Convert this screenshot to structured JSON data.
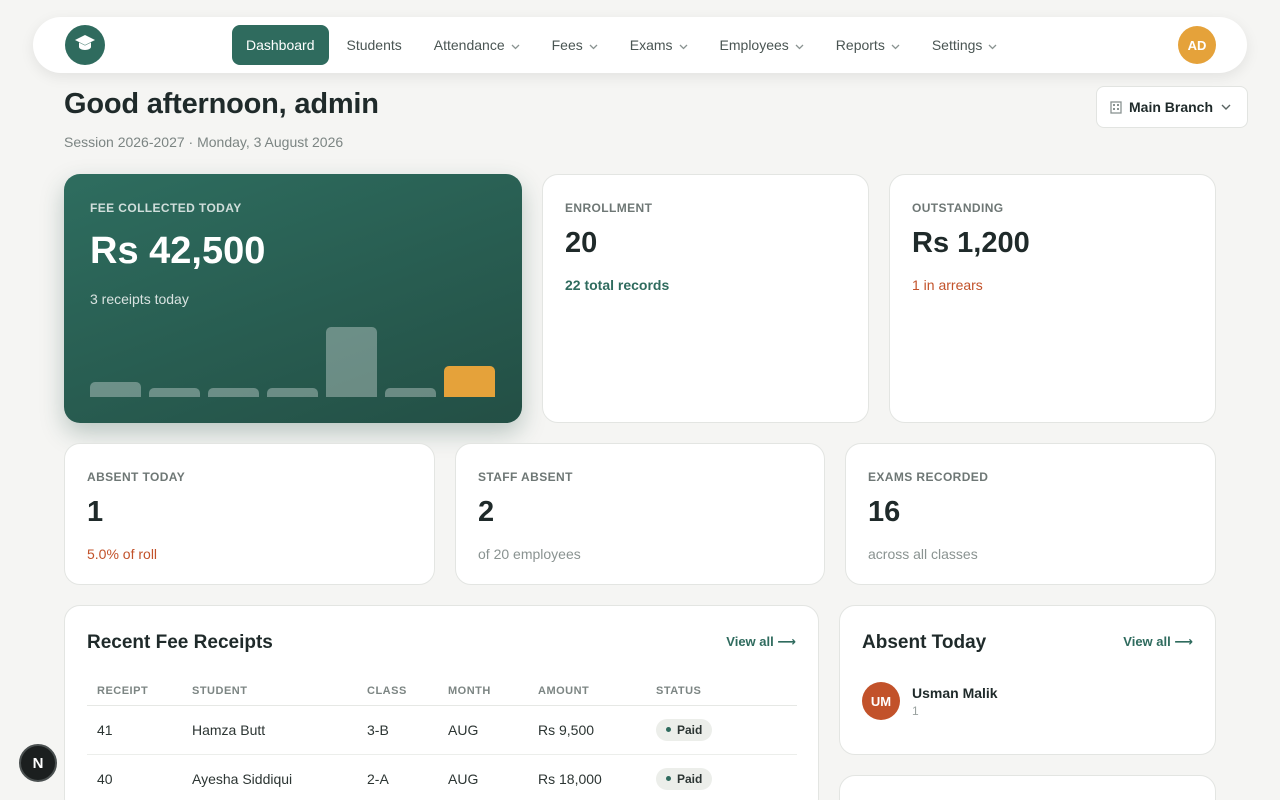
{
  "nav": {
    "logo_icon": "graduation-cap-icon",
    "items": [
      {
        "label": "Dashboard",
        "active": true,
        "dropdown": false
      },
      {
        "label": "Students",
        "active": false,
        "dropdown": false
      },
      {
        "label": "Attendance",
        "active": false,
        "dropdown": true
      },
      {
        "label": "Fees",
        "active": false,
        "dropdown": true
      },
      {
        "label": "Exams",
        "active": false,
        "dropdown": true
      },
      {
        "label": "Employees",
        "active": false,
        "dropdown": true
      },
      {
        "label": "Reports",
        "active": false,
        "dropdown": true
      },
      {
        "label": "Settings",
        "active": false,
        "dropdown": true
      }
    ],
    "avatar_initials": "AD"
  },
  "header": {
    "greeting": "Good afternoon, admin",
    "session": "Session 2026-2027 · Monday, 3 August 2026",
    "branch_label": "Main Branch"
  },
  "hero": {
    "label": "FEE COLLECTED TODAY",
    "value": "Rs 42,500",
    "sub": "3 receipts today",
    "bars": [
      0.21,
      0.13,
      0.13,
      0.13,
      1.0,
      0.13,
      0.44
    ],
    "highlight_index": 6
  },
  "stats": {
    "enrollment": {
      "label": "ENROLLMENT",
      "value": "20",
      "sub": "22 total records"
    },
    "outstanding": {
      "label": "OUTSTANDING",
      "value": "Rs 1,200",
      "sub": "1 in arrears"
    },
    "absent_today": {
      "label": "ABSENT TODAY",
      "value": "1",
      "sub": "5.0% of roll"
    },
    "staff_absent": {
      "label": "STAFF ABSENT",
      "value": "2",
      "sub": "of 20 employees"
    },
    "exams_recorded": {
      "label": "EXAMS RECORDED",
      "value": "16",
      "sub": "across all classes"
    }
  },
  "receipts": {
    "title": "Recent Fee Receipts",
    "view_all": "View all",
    "columns": [
      "RECEIPT",
      "STUDENT",
      "CLASS",
      "MONTH",
      "AMOUNT",
      "STATUS"
    ],
    "rows": [
      {
        "receipt": "41",
        "student": "Hamza Butt",
        "class": "3-B",
        "month": "AUG",
        "amount": "Rs 9,500",
        "status": "Paid"
      },
      {
        "receipt": "40",
        "student": "Ayesha Siddiqui",
        "class": "2-A",
        "month": "AUG",
        "amount": "Rs 18,000",
        "status": "Paid"
      }
    ]
  },
  "absent_panel": {
    "title": "Absent Today",
    "view_all": "View all",
    "people": [
      {
        "initials": "UM",
        "name": "Usman Malik",
        "roll": "1"
      }
    ]
  },
  "colors": {
    "accent": "#2f6b5e",
    "highlight": "#e5a23a",
    "danger": "#c2522a"
  },
  "next_badge": "N"
}
